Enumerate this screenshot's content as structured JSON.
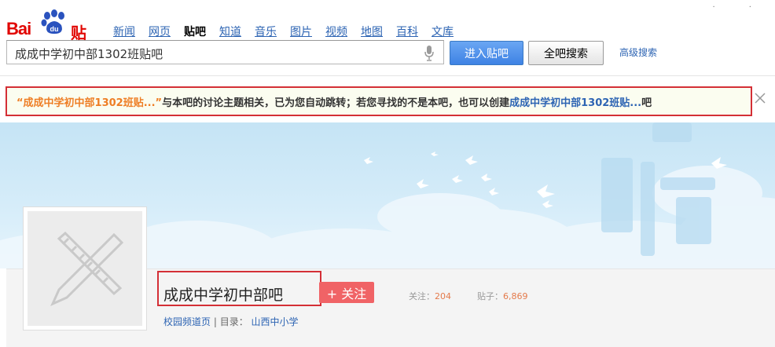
{
  "logo": {
    "text_bai": "Bai",
    "text_du": "du",
    "text_tieba": "贴吧"
  },
  "nav": [
    {
      "label": "新闻",
      "active": false
    },
    {
      "label": "网页",
      "active": false
    },
    {
      "label": "贴吧",
      "active": true
    },
    {
      "label": "知道",
      "active": false
    },
    {
      "label": "音乐",
      "active": false
    },
    {
      "label": "图片",
      "active": false
    },
    {
      "label": "视频",
      "active": false
    },
    {
      "label": "地图",
      "active": false
    },
    {
      "label": "百科",
      "active": false
    },
    {
      "label": "文库",
      "active": false
    }
  ],
  "search": {
    "value": "成成中学初中部1302班贴吧",
    "icon": "microphone-icon"
  },
  "buttons": {
    "enter": "进入贴吧",
    "search_all": "全吧搜索",
    "advanced": "高级搜索"
  },
  "notice": {
    "part1": "“成成中学初中部1302班贴...”",
    "part2": "与本吧的讨论主题相关，已为您自动跳转；若您寻找的不是本吧，也可以创建",
    "part3": "成成中学初中部1302班贴...",
    "part4": "吧",
    "close_icon": "close-icon"
  },
  "forum": {
    "name": "成成中学初中部吧",
    "follow_label": "+ 关注",
    "follow_stat_label": "关注：",
    "follow_count": "204",
    "posts_stat_label": "贴子：",
    "posts_count": "6,869",
    "channel_link": "校园频道页",
    "directory_label": "| 目录：",
    "directory_link": "山西中小学"
  },
  "colors": {
    "brand_red": "#e10602",
    "link_blue": "#2d64b3",
    "notice_orange": "#ee7e25",
    "follow_red": "#f06366"
  }
}
